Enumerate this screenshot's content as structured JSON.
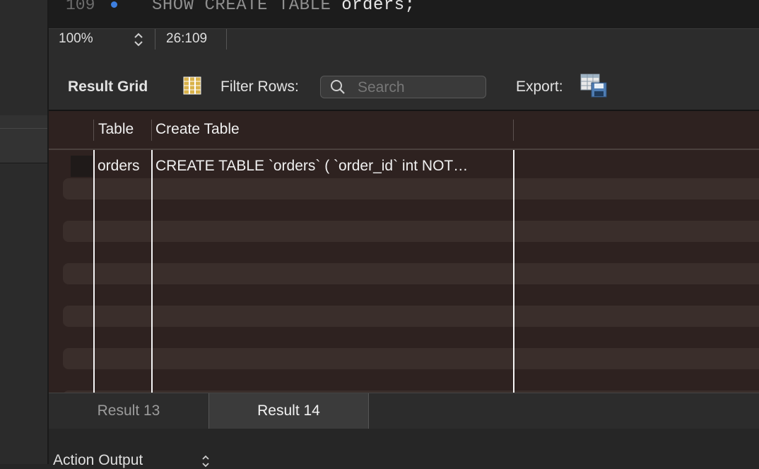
{
  "editor": {
    "line_number": "109",
    "code_keyword": "SHOW CREATE TABLE",
    "code_identifier": "orders;"
  },
  "statusbar": {
    "zoom": "100%",
    "cursor_position": "26:109"
  },
  "toolbar": {
    "result_grid_label": "Result Grid",
    "filter_rows_label": "Filter Rows:",
    "search_placeholder": "Search",
    "export_label": "Export:",
    "grid_icon": "grid-view-icon",
    "export_icon": "export-table-icon"
  },
  "grid": {
    "columns": [
      "Table",
      "Create Table"
    ],
    "rows": [
      [
        "orders",
        "CREATE TABLE `orders` (   `order_id` int NOT…"
      ]
    ]
  },
  "tabs": [
    {
      "label": "Result 13",
      "active": false
    },
    {
      "label": "Result 14",
      "active": true
    }
  ],
  "action_output": {
    "label": "Action Output"
  },
  "colors": {
    "accent_dot": "#3d7fe0",
    "grid_background": "#2e2220",
    "stripe": "#3a2e2b"
  }
}
